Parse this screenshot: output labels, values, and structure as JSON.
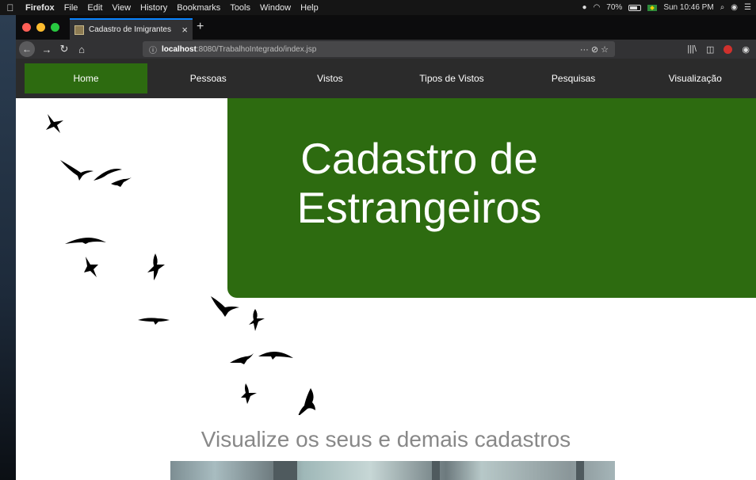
{
  "menubar": {
    "app_name": "Firefox",
    "items": [
      "File",
      "Edit",
      "View",
      "History",
      "Bookmarks",
      "Tools",
      "Window",
      "Help"
    ],
    "battery": "70%",
    "clock": "Sun 10:46 PM"
  },
  "browser": {
    "tab_title": "Cadastro de Imigrantes",
    "new_tab": "+",
    "tab_close": "×",
    "url_host": "localhost",
    "url_path": ":8080/TrabalhoIntegrado/index.jsp",
    "url_actions": "··· ⊘ ☆"
  },
  "site": {
    "nav": [
      "Home",
      "Pessoas",
      "Vistos",
      "Tipos de Vistos",
      "Pesquisas",
      "Visualização"
    ],
    "hero_line1": "Cadastro de",
    "hero_line2": "Estrangeiros",
    "subtitle": "Visualize os seus e demais cadastros"
  },
  "colors": {
    "nav_bg": "#2b2b2b",
    "accent_green": "#2d6b10",
    "subtitle_gray": "#888888"
  }
}
